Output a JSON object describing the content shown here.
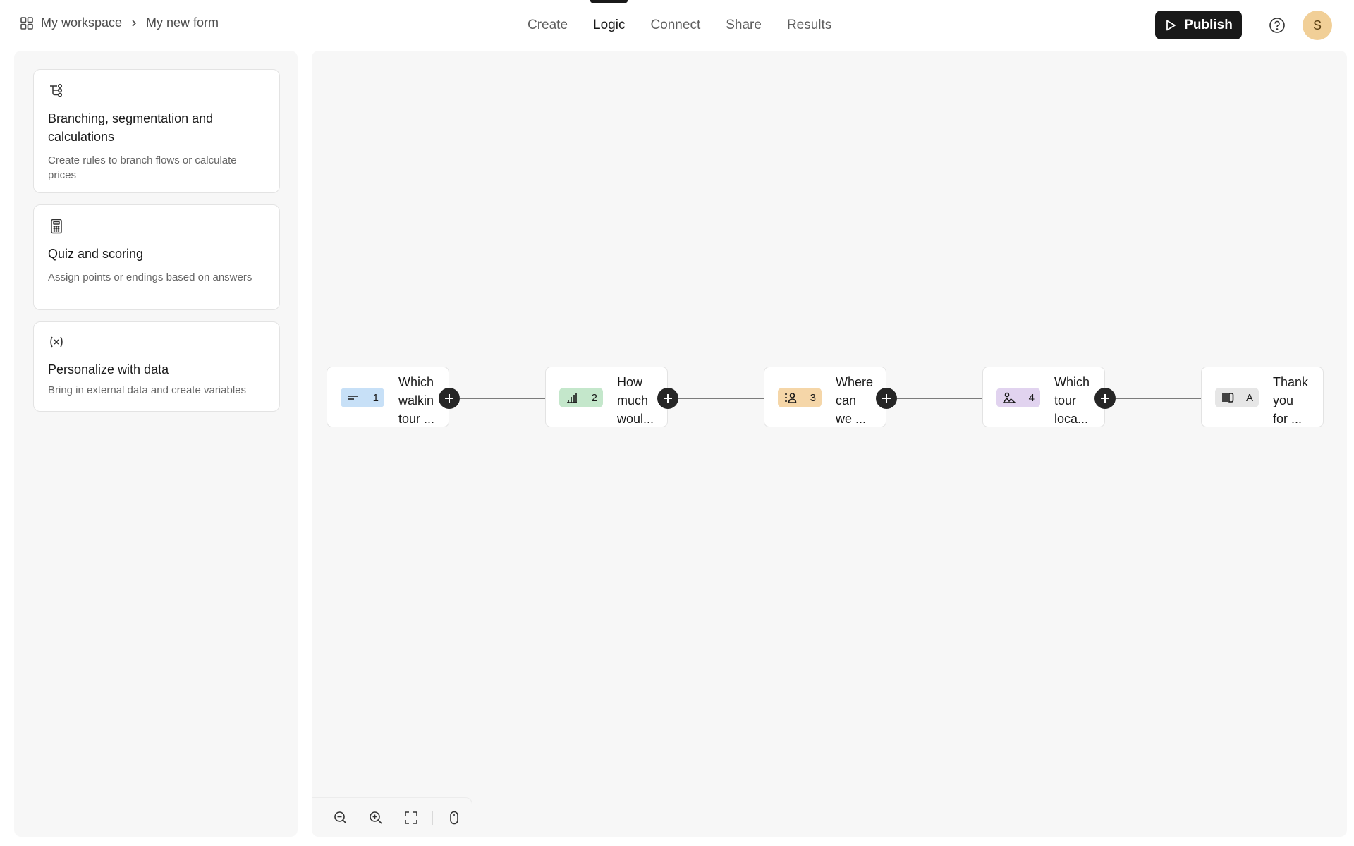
{
  "breadcrumb": {
    "workspace": "My workspace",
    "form": "My new form"
  },
  "tabs": [
    {
      "label": "Create",
      "active": false
    },
    {
      "label": "Logic",
      "active": true
    },
    {
      "label": "Connect",
      "active": false
    },
    {
      "label": "Share",
      "active": false
    },
    {
      "label": "Results",
      "active": false
    }
  ],
  "header": {
    "publish_label": "Publish",
    "avatar_initial": "S"
  },
  "cards": [
    {
      "icon": "branch-icon",
      "title": "Branching, segmentation and calculations",
      "desc": "Create rules to branch flows or calculate prices"
    },
    {
      "icon": "calculator-icon",
      "title": "Quiz and scoring",
      "desc": "Assign points or endings based on answers"
    },
    {
      "icon": "variable-icon",
      "title": "Personalize with data",
      "desc": "Bring in external data and create variables"
    }
  ],
  "nodes": [
    {
      "badge": "1",
      "icon": "short-text-icon",
      "color": "#c7e0f7",
      "text": "Which\nwalkin\ntour ..."
    },
    {
      "badge": "2",
      "icon": "bar-chart-icon",
      "color": "#c4e7cb",
      "text": "How\nmuch\nwoul..."
    },
    {
      "badge": "3",
      "icon": "contact-icon",
      "color": "#f5d6a8",
      "text": "Where\ncan\nwe ..."
    },
    {
      "badge": "4",
      "icon": "picture-choice-icon",
      "color": "#e1d3ef",
      "text": "Which\ntour\nloca..."
    },
    {
      "badge": "A",
      "icon": "ending-icon",
      "color": "#e6e6e6",
      "text": "Thank\nyou\nfor ..."
    }
  ],
  "colors": {
    "primary": "#191919",
    "canvas": "#f7f7f7",
    "avatar": "#f1cf97"
  }
}
